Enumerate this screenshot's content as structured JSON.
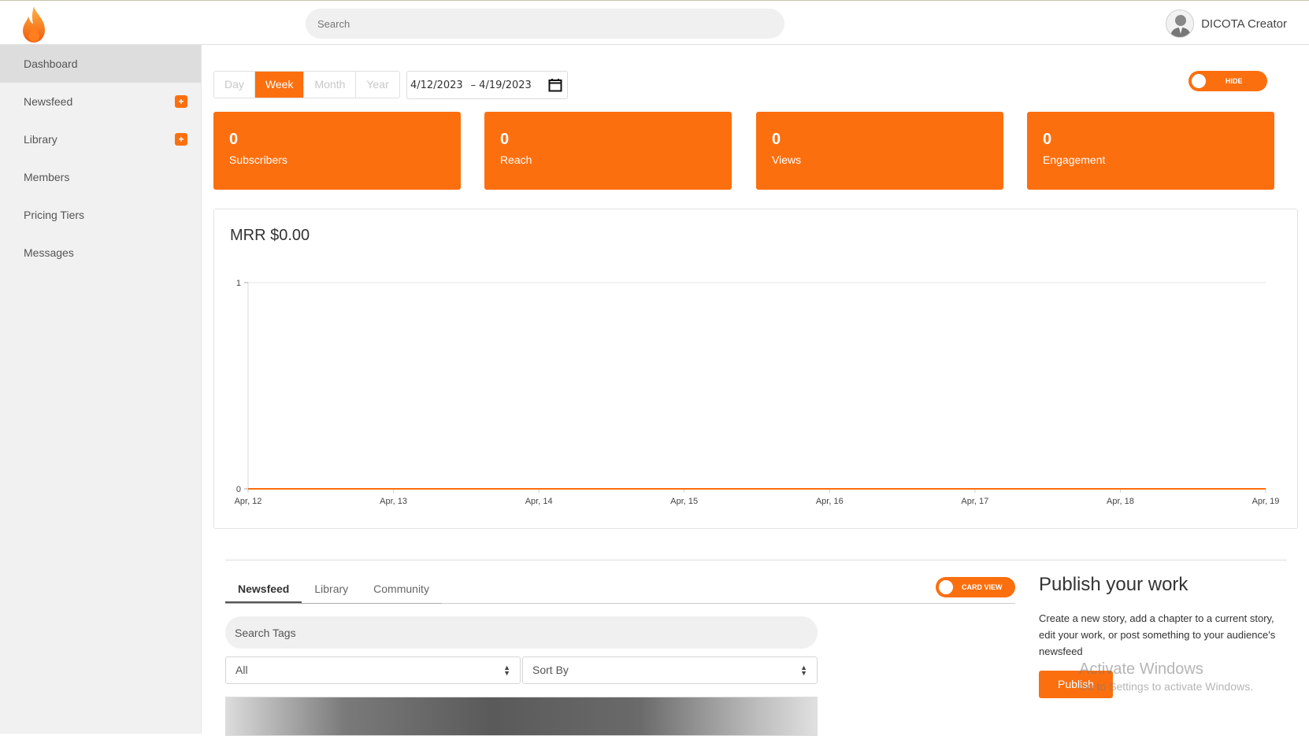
{
  "header": {
    "search_placeholder": "Search",
    "username": "DICOTA Creator"
  },
  "sidebar": {
    "items": [
      {
        "label": "Dashboard",
        "active": true,
        "plus": false
      },
      {
        "label": "Newsfeed",
        "active": false,
        "plus": true
      },
      {
        "label": "Library",
        "active": false,
        "plus": true
      },
      {
        "label": "Members",
        "active": false,
        "plus": false
      },
      {
        "label": "Pricing Tiers",
        "active": false,
        "plus": false
      },
      {
        "label": "Messages",
        "active": false,
        "plus": false
      }
    ],
    "plus_symbol": "+"
  },
  "period": {
    "options": [
      "Day",
      "Week",
      "Month",
      "Year"
    ],
    "selected": "Week"
  },
  "date_range": {
    "start": "4/12/2023",
    "separator": "–",
    "end": "4/19/2023"
  },
  "hide_toggle": {
    "label": "HIDE"
  },
  "stats": [
    {
      "value": "0",
      "label": "Subscribers"
    },
    {
      "value": "0",
      "label": "Reach"
    },
    {
      "value": "0",
      "label": "Views"
    },
    {
      "value": "0",
      "label": "Engagement"
    }
  ],
  "mrr": {
    "title": "MRR $0.00"
  },
  "chart_data": {
    "type": "line",
    "title": "MRR $0.00",
    "categories": [
      "Apr, 12",
      "Apr, 13",
      "Apr, 14",
      "Apr, 15",
      "Apr, 16",
      "Apr, 17",
      "Apr, 18",
      "Apr, 19"
    ],
    "values": [
      0,
      0,
      0,
      0,
      0,
      0,
      0,
      0
    ],
    "y_ticks": [
      "0",
      "1"
    ],
    "ylim": [
      0,
      1
    ],
    "grid": true,
    "line_color": "#fc6f0f"
  },
  "feed": {
    "tabs": [
      "Newsfeed",
      "Library",
      "Community"
    ],
    "active_tab": "Newsfeed",
    "card_view_label": "CARD VIEW",
    "tag_search_placeholder": "Search Tags",
    "filter_selected": "All",
    "sort_selected": "Sort By"
  },
  "publish": {
    "title": "Publish your work",
    "description": "Create a new story, add a chapter to a current story, edit your work, or post something to your audience's newsfeed",
    "button": "Publish"
  },
  "watermark": {
    "line1": "Activate Windows",
    "line2": "Go to Settings to activate Windows."
  },
  "colors": {
    "accent": "#fc6f0f",
    "sidebar_bg": "#f1f1f1"
  }
}
